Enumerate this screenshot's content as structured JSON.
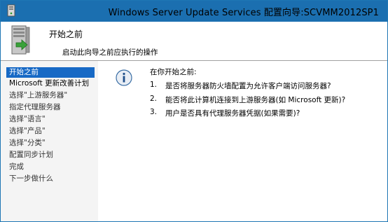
{
  "window": {
    "title": "Windows Server Update Services 配置向导:SCVMM2012SP1",
    "accent_color": "#1b6fb0",
    "app_icon": "wsus-server-icon"
  },
  "header": {
    "title": "开始之前",
    "subtitle": "启动此向导之前应执行的操作",
    "icon": "server-arrow-icon"
  },
  "sidebar": {
    "items": [
      {
        "label": "开始之前",
        "active": true
      },
      {
        "label": "Microsoft 更新改善计划",
        "active": false
      },
      {
        "label": "选择\"上游服务器\"",
        "active": false
      },
      {
        "label": "指定代理服务器",
        "active": false
      },
      {
        "label": "选择\"语言\"",
        "active": false
      },
      {
        "label": "选择\"产品\"",
        "active": false
      },
      {
        "label": "选择\"分类\"",
        "active": false
      },
      {
        "label": "配置同步计划",
        "active": false
      },
      {
        "label": "完成",
        "active": false
      },
      {
        "label": "下一步做什么",
        "active": false
      }
    ]
  },
  "content": {
    "heading": "在你开始之前:",
    "icon": "info-icon",
    "questions": [
      {
        "number": "1.",
        "text": "是否将服务器防火墙配置为允许客户端访问服务器?"
      },
      {
        "number": "2.",
        "text": "能否将此计算机连接到上游服务器(如 Microsoft 更新)?"
      },
      {
        "number": "3.",
        "text": "用户是否具有代理服务器凭据(如果需要)?"
      }
    ]
  }
}
